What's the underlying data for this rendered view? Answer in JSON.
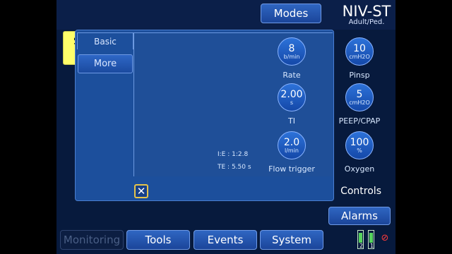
{
  "header": {
    "modes_label": "Modes",
    "mode_name": "NIV-ST",
    "patient_type": "Adult/Ped."
  },
  "status": {
    "standby_label": "Standby"
  },
  "controls_panel": {
    "tabs": [
      {
        "label": "Basic"
      },
      {
        "label": "More"
      }
    ],
    "title": "Controls",
    "params": {
      "rate": {
        "value": "8",
        "unit": "b/min",
        "label": "Rate"
      },
      "pinsp": {
        "value": "10",
        "unit": "cmH2O",
        "label": "Pinsp"
      },
      "ti": {
        "value": "2.00",
        "unit": "s",
        "label": "TI"
      },
      "peep": {
        "value": "5",
        "unit": "cmH2O",
        "label": "PEEP/CPAP"
      },
      "flow_trigger": {
        "value": "2.0",
        "unit": "l/min",
        "label": "Flow trigger"
      },
      "oxygen": {
        "value": "100",
        "unit": "%",
        "label": "Oxygen"
      }
    },
    "ie_ratio": "I:E : 1:2.8",
    "te": "TE : 5.50 s"
  },
  "alarms_label": "Alarms",
  "bottom_nav": {
    "monitoring": "Monitoring",
    "tools": "Tools",
    "events": "Events",
    "system": "System"
  },
  "batteries": [
    {
      "number": "2"
    },
    {
      "number": "1"
    }
  ],
  "icons": {
    "close": "close-icon",
    "power_disconnected": "plug-disconnected-icon"
  },
  "colors": {
    "standby_yellow": "#ffff6a",
    "panel_blue": "#1c4f9c",
    "close_border": "#e6c44a",
    "battery_green": "#56d45c",
    "alert_red": "#ff3b3b"
  }
}
